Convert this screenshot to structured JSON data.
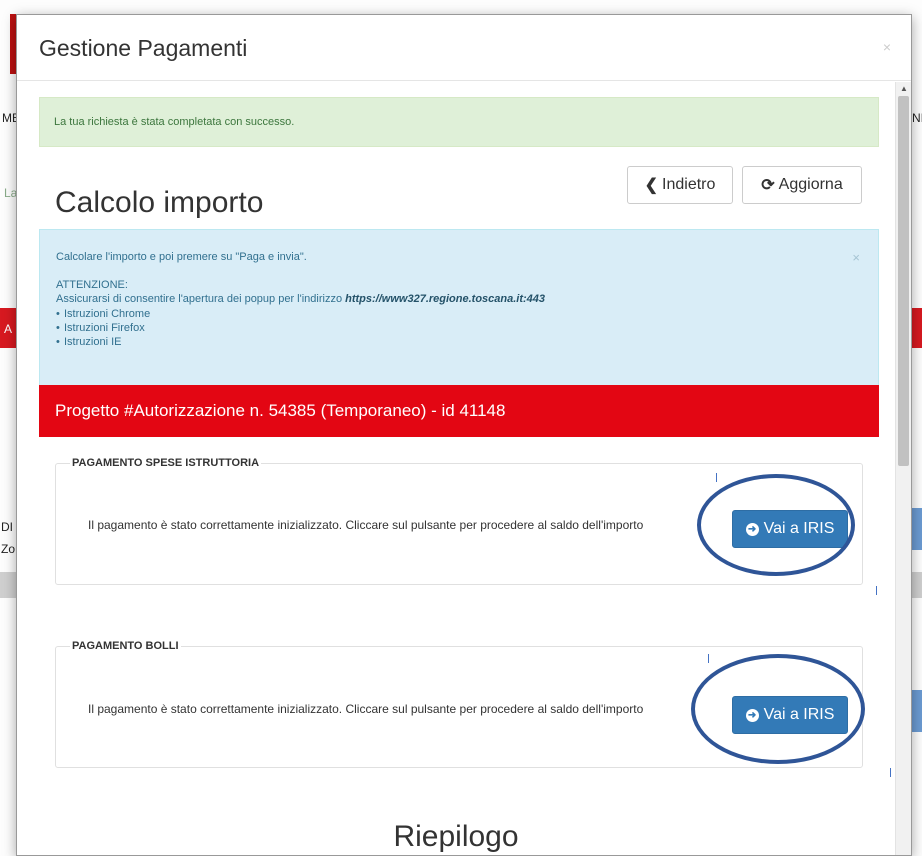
{
  "modal": {
    "title": "Gestione Pagamenti",
    "close": "×"
  },
  "success_alert": {
    "text": "La tua richiesta è stata completata con successo."
  },
  "section": {
    "title": "Calcolo importo",
    "back_label": "Indietro",
    "refresh_label": "Aggiorna"
  },
  "info_alert": {
    "line1": "Calcolare l'importo e poi premere su \"Paga e invia\".",
    "attention_heading": "ATTENZIONE:",
    "attention_text": "Assicurarsi di consentire l'apertura dei popup per l'indirizzo",
    "url": "https://www327.regione.toscana.it:443",
    "items": [
      "Istruzioni Chrome",
      "Istruzioni Firefox",
      "Istruzioni IE"
    ],
    "close": "×"
  },
  "project": {
    "title": "Progetto #Autorizzazione n. 54385 (Temporaneo) - id 41148"
  },
  "payments": [
    {
      "legend": "PAGAMENTO SPESE ISTRUTTORIA",
      "text": "Il pagamento è stato correttamente inizializzato. Cliccare sul pulsante per procedere al saldo dell'importo",
      "button": "Vai a IRIS"
    },
    {
      "legend": "PAGAMENTO BOLLI",
      "text": "Il pagamento è stato correttamente inizializzato. Cliccare sul pulsante per procedere al saldo dell'importo",
      "button": "Vai a IRIS"
    }
  ],
  "summary": {
    "title": "Riepilogo"
  },
  "background_fragments": [
    "ME",
    "NI",
    "La",
    "A",
    "E",
    "DI",
    "Zo"
  ],
  "colors": {
    "primary": "#337ab7",
    "project_bar": "#e30613",
    "success_bg": "#dff0d8",
    "info_bg": "#d9edf7",
    "annotation": "#2f5597"
  }
}
